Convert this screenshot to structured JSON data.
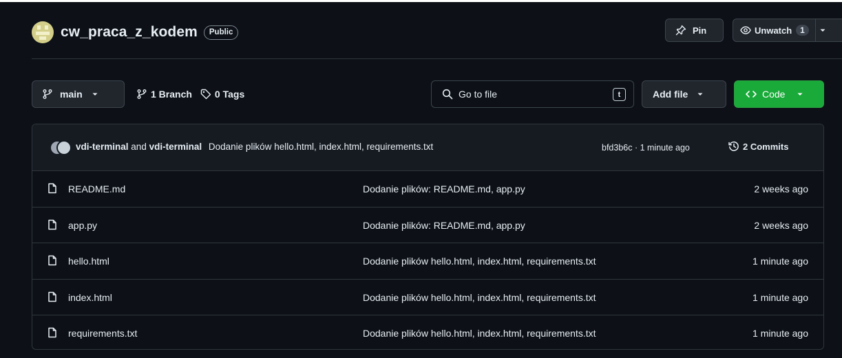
{
  "repo": {
    "name": "cw_praca_z_kodem",
    "visibility": "Public"
  },
  "header_actions": {
    "pin_label": "Pin",
    "unwatch_label": "Unwatch",
    "watch_count": "1"
  },
  "toolbar": {
    "branch_label": "main",
    "branches_link": "1 Branch",
    "tags_link": "0 Tags",
    "search_placeholder": "Go to file",
    "search_shortcut": "t",
    "add_file_label": "Add file",
    "code_label": "Code"
  },
  "latest_commit": {
    "author1": "vdi-terminal",
    "and_text": "and",
    "author2": "vdi-terminal",
    "message": "Dodanie plików hello.html, index.html, requirements.txt",
    "meta": "bfd3b6c · 1 minute ago",
    "commits_label": "2 Commits"
  },
  "files": [
    {
      "name": "README.md",
      "message": "Dodanie plików: README.md, app.py",
      "date": "2 weeks ago"
    },
    {
      "name": "app.py",
      "message": "Dodanie plików: README.md, app.py",
      "date": "2 weeks ago"
    },
    {
      "name": "hello.html",
      "message": "Dodanie plików hello.html, index.html, requirements.txt",
      "date": "1 minute ago"
    },
    {
      "name": "index.html",
      "message": "Dodanie plików hello.html, index.html, requirements.txt",
      "date": "1 minute ago"
    },
    {
      "name": "requirements.txt",
      "message": "Dodanie plików hello.html, index.html, requirements.txt",
      "date": "1 minute ago"
    }
  ],
  "colors": {
    "background": "#0d1117",
    "code_button": "#1aaa3a",
    "border": "#30363d"
  }
}
